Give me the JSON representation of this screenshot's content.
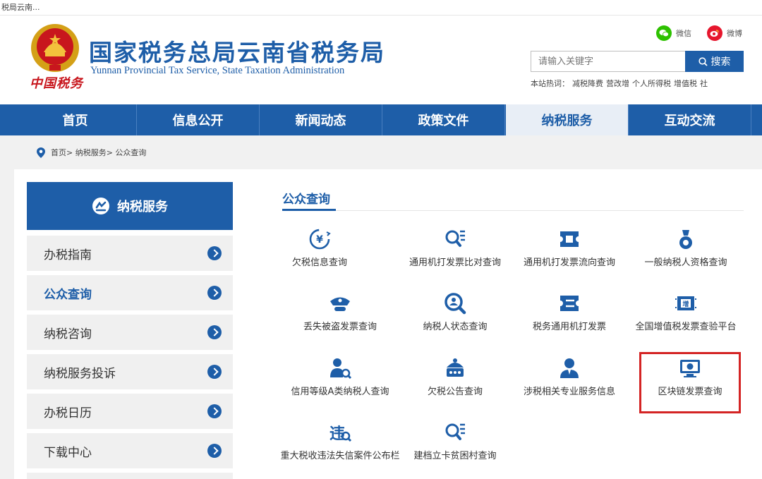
{
  "browser": {
    "tab_title": "税局云南..."
  },
  "header": {
    "title": "国家税务总局云南省税务局",
    "subtitle": "Yunnan Provincial Tax Service, State Taxation Administration",
    "logo_text": "中国税务",
    "social": {
      "wechat": "微信",
      "weibo": "微博"
    },
    "search": {
      "placeholder": "请输入关键字",
      "button": "搜索"
    },
    "hot": {
      "label": "本站热词：",
      "terms": [
        "减税降费",
        "营改增",
        "个人所得税",
        "增值税",
        "社"
      ]
    }
  },
  "nav": [
    "首页",
    "信息公开",
    "新闻动态",
    "政策文件",
    "纳税服务",
    "互动交流"
  ],
  "breadcrumb": "首页> 纳税服务> 公众查询",
  "sidebar": {
    "title": "纳税服务",
    "items": [
      "办税指南",
      "公众查询",
      "纳税咨询",
      "纳税服务投诉",
      "办税日历",
      "下载中心"
    ]
  },
  "section_title": "公众查询",
  "services": [
    "欠税信息查询",
    "通用机打发票比对查询",
    "通用机打发票流向查询",
    "一般纳税人资格查询",
    "丢失被盗发票查询",
    "纳税人状态查询",
    "税务通用机打发票",
    "全国增值税发票查验平台",
    "信用等级A类纳税人查询",
    "欠税公告查询",
    "涉税相关专业服务信息",
    "区块链发票查询",
    "重大税收违法失信案件公布栏",
    "建档立卡贫困村查询"
  ],
  "colors": {
    "primary": "#1e5ea8",
    "highlight": "#d42424",
    "wechat": "#2dc100",
    "weibo": "#e6162d"
  }
}
